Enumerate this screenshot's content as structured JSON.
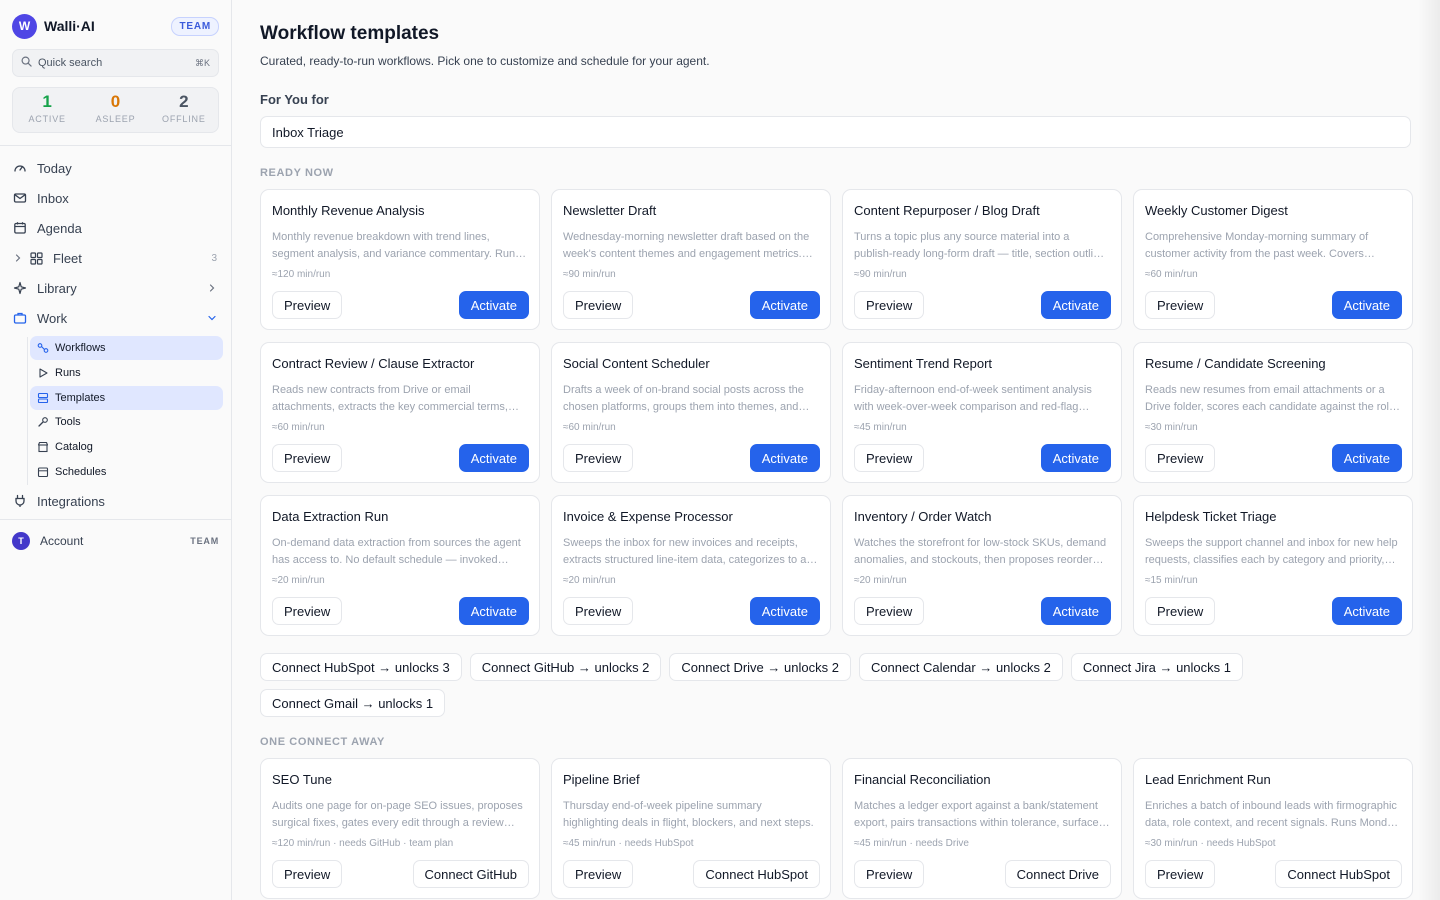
{
  "brand": {
    "logo_letter": "W",
    "name": "Walli·AI",
    "badge": "TEAM"
  },
  "search": {
    "placeholder": "Quick search",
    "shortcut": "⌘K"
  },
  "stats": [
    {
      "value": "1",
      "label": "ACTIVE",
      "color": "#16a34a"
    },
    {
      "value": "0",
      "label": "ASLEEP",
      "color": "#d97706"
    },
    {
      "value": "2",
      "label": "OFFLINE",
      "color": "#4b5563"
    }
  ],
  "nav": {
    "today": "Today",
    "inbox": "Inbox",
    "agenda": "Agenda",
    "fleet": "Fleet",
    "fleet_count": "3",
    "library": "Library",
    "work": "Work",
    "integrations": "Integrations"
  },
  "work_sub": {
    "workflows": "Workflows",
    "runs": "Runs",
    "templates": "Templates",
    "tools": "Tools",
    "catalog": "Catalog",
    "schedules": "Schedules"
  },
  "account": {
    "avatar": "T",
    "label": "Account",
    "tag": "TEAM"
  },
  "main": {
    "title": "Workflow templates",
    "subtitle": "Curated, ready-to-run workflows. Pick one to customize and schedule for your agent.",
    "for_you_label": "For You for",
    "for_you_value": "Inbox Triage",
    "ready_label": "READY NOW",
    "away_label": "ONE CONNECT AWAY",
    "preview_label": "Preview",
    "activate_label": "Activate"
  },
  "ready_cards": [
    {
      "title": "Monthly Revenue Analysis",
      "desc": "Monthly revenue breakdown with trend lines, segment analysis, and variance commentary. Runs on the first business day of the month.",
      "meta": "≈120 min/run"
    },
    {
      "title": "Newsletter Draft",
      "desc": "Wednesday-morning newsletter draft based on the week's content themes and engagement metrics. Includes subject line options.",
      "meta": "≈90 min/run"
    },
    {
      "title": "Content Repurposer / Blog Draft",
      "desc": "Turns a topic plus any source material into a publish-ready long-form draft — title, section outline, full body and meta description.",
      "meta": "≈90 min/run"
    },
    {
      "title": "Weekly Customer Digest",
      "desc": "Comprehensive Monday-morning summary of customer activity from the past week. Covers tickets, churn signals and expansion.",
      "meta": "≈60 min/run"
    },
    {
      "title": "Contract Review / Clause Extractor",
      "desc": "Reads new contracts from Drive or email attachments, extracts the key commercial terms, and flags risky clauses.",
      "meta": "≈60 min/run"
    },
    {
      "title": "Social Content Scheduler",
      "desc": "Drafts a week of on-brand social posts across the chosen platforms, groups them into themes, and queues them for review.",
      "meta": "≈60 min/run"
    },
    {
      "title": "Sentiment Trend Report",
      "desc": "Friday-afternoon end-of-week sentiment analysis with week-over-week comparison and red-flag callouts.",
      "meta": "≈45 min/run"
    },
    {
      "title": "Resume / Candidate Screening",
      "desc": "Reads new resumes from email attachments or a Drive folder, scores each candidate against the role rubric.",
      "meta": "≈30 min/run"
    },
    {
      "title": "Data Extraction Run",
      "desc": "On-demand data extraction from sources the agent has access to. No default schedule — invoked manually.",
      "meta": "≈20 min/run"
    },
    {
      "title": "Invoice & Expense Processor",
      "desc": "Sweeps the inbox for new invoices and receipts, extracts structured line-item data, categorizes to a ledger.",
      "meta": "≈20 min/run"
    },
    {
      "title": "Inventory / Order Watch",
      "desc": "Watches the storefront for low-stock SKUs, demand anomalies, and stockouts, then proposes reorder quantities.",
      "meta": "≈20 min/run"
    },
    {
      "title": "Helpdesk Ticket Triage",
      "desc": "Sweeps the support channel and inbox for new help requests, classifies each by category and priority, and routes them.",
      "meta": "≈15 min/run"
    }
  ],
  "connect_chips": [
    "Connect HubSpot → unlocks 3",
    "Connect GitHub → unlocks 2",
    "Connect Drive → unlocks 2",
    "Connect Calendar → unlocks 2",
    "Connect Jira → unlocks 1",
    "Connect Gmail → unlocks 1"
  ],
  "away_cards": [
    {
      "title": "SEO Tune",
      "desc": "Audits one page for on-page SEO issues, proposes surgical fixes, gates every edit through a review step.",
      "meta": "≈120 min/run · needs GitHub · team plan",
      "connect": "Connect GitHub"
    },
    {
      "title": "Pipeline Brief",
      "desc": "Thursday end-of-week pipeline summary highlighting deals in flight, blockers, and next steps.",
      "meta": "≈45 min/run · needs HubSpot",
      "connect": "Connect HubSpot"
    },
    {
      "title": "Financial Reconciliation",
      "desc": "Matches a ledger export against a bank/statement export, pairs transactions within tolerance, surfaces exceptions.",
      "meta": "≈45 min/run · needs Drive",
      "connect": "Connect Drive"
    },
    {
      "title": "Lead Enrichment Run",
      "desc": "Enriches a batch of inbound leads with firmographic data, role context, and recent signals. Runs Monday mornings.",
      "meta": "≈30 min/run · needs HubSpot",
      "connect": "Connect HubSpot"
    }
  ]
}
